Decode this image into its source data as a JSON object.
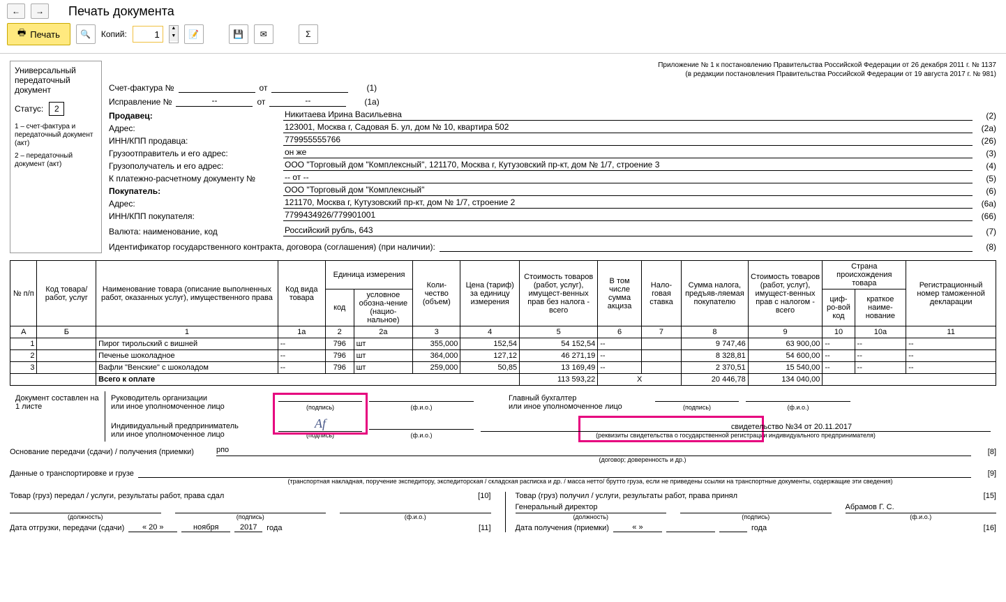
{
  "toolbar": {
    "title": "Печать документа",
    "print": "Печать",
    "copies_lbl": "Копий:",
    "copies": "1"
  },
  "sidebar": {
    "l1": "Универсальный",
    "l2": "передаточный",
    "l3": "документ",
    "status_lbl": "Статус:",
    "status": "2",
    "n1": "1 – счет-фактура и передаточный документ (акт)",
    "n2": "2 – передаточный документ (акт)"
  },
  "hdr": {
    "r1": "Приложение № 1 к постановлению Правительства Российской Федерации от 26 декабря 2011 г. № 1137",
    "r2": "(в редакции постановления Правительства Российской Федерации от 19 августа 2017 г. № 981)"
  },
  "sf": {
    "l1": "Счет-фактура №",
    "ot": "от",
    "n1": "(1)",
    "l2": "Исправление №",
    "dash": "--",
    "n2": "(1а)"
  },
  "f": {
    "seller_l": "Продавец:",
    "seller_v": "Никитаева Ирина Васильевна",
    "seller_n": "(2)",
    "addr_l": "Адрес:",
    "addr_v": "123001, Москва г, Садовая Б. ул, дом № 10, квартира 502",
    "addr_n": "(2а)",
    "inn_l": "ИНН/КПП продавца:",
    "inn_v": "779955555766",
    "inn_n": "(26)",
    "ship_l": "Грузоотправитель и его адрес:",
    "ship_v": "он же",
    "ship_n": "(3)",
    "cons_l": "Грузополучатель и его адрес:",
    "cons_v": "ООО \"Торговый дом \"Комплексный\", 121170, Москва г, Кутузовский пр-кт, дом № 1/7, строение 3",
    "cons_n": "(4)",
    "pay_l": "К платежно-расчетному документу №",
    "pay_v": "-- от --",
    "pay_n": "(5)",
    "buyer_l": "Покупатель:",
    "buyer_v": "ООО \"Торговый дом \"Комплексный\"",
    "buyer_n": "(6)",
    "baddr_l": "Адрес:",
    "baddr_v": "121170, Москва г, Кутузовский пр-кт, дом № 1/7, строение 2",
    "baddr_n": "(6а)",
    "binn_l": "ИНН/КПП покупателя:",
    "binn_v": "7799434926/779901001",
    "binn_n": "(66)",
    "cur_l": "Валюта: наименование, код",
    "cur_v": "Российский рубль, 643",
    "cur_n": "(7)",
    "gk_l": "Идентификатор государственного контракта, договора (соглашения) (при наличии):",
    "gk_v": "",
    "gk_n": "(8)"
  },
  "th": {
    "c1": "№ п/п",
    "c2": "Код товара/ работ, услуг",
    "c3": "Наименование товара (описание выполненных работ, оказанных услуг), имущественного права",
    "c4": "Код вида товара",
    "c5": "Единица измерения",
    "c5a": "код",
    "c5b": "условное обозна-чение (нацио-нальное)",
    "c6": "Коли-чество (объем)",
    "c7": "Цена (тариф) за единицу измерения",
    "c8": "Стоимость товаров (работ, услуг), имущест-венных прав без налога - всего",
    "c9": "В том числе сумма акциза",
    "c10": "Нало-говая ставка",
    "c11": "Сумма налога, предъяв-ляемая покупателю",
    "c12": "Стоимость товаров (работ, услуг), имущест-венных прав с налогом - всего",
    "c13": "Страна происхождения товара",
    "c13a": "циф-ро-вой код",
    "c13b": "краткое наиме-нование",
    "c14": "Регистрационный номер таможенной декларации",
    "rA": "А",
    "rB": "Б",
    "r1": "1",
    "r1a": "1а",
    "r2": "2",
    "r2a": "2а",
    "r3": "3",
    "r4": "4",
    "r5": "5",
    "r6": "6",
    "r7": "7",
    "r8": "8",
    "r9": "9",
    "r10": "10",
    "r10a": "10а",
    "r11": "11"
  },
  "rows": [
    {
      "n": "1",
      "name": "Пирог тирольский с вишней",
      "kvt": "--",
      "kod": "796",
      "ed": "шт",
      "qty": "355,000",
      "price": "152,54",
      "sum": "54 152,54",
      "akc": "--",
      "st": "",
      "tax": "9 747,46",
      "tot": "63 900,00",
      "c10": "--",
      "c10a": "--",
      "c11": "--"
    },
    {
      "n": "2",
      "name": "Печенье шоколадное",
      "kvt": "--",
      "kod": "796",
      "ed": "шт",
      "qty": "364,000",
      "price": "127,12",
      "sum": "46 271,19",
      "akc": "--",
      "st": "",
      "tax": "8 328,81",
      "tot": "54 600,00",
      "c10": "--",
      "c10a": "--",
      "c11": "--"
    },
    {
      "n": "3",
      "name": "Вафли \"Венские\" с шоколадом",
      "kvt": "--",
      "kod": "796",
      "ed": "шт",
      "qty": "259,000",
      "price": "50,85",
      "sum": "13 169,49",
      "akc": "--",
      "st": "",
      "tax": "2 370,51",
      "tot": "15 540,00",
      "c10": "--",
      "c10a": "--",
      "c11": "--"
    }
  ],
  "total": {
    "lbl": "Всего к оплате",
    "sum": "113 593,22",
    "x": "Х",
    "tax": "20 446,78",
    "tot": "134 040,00"
  },
  "sign": {
    "doc": "Документ составлен на",
    "sheets": "1 листе",
    "r1": "Руководитель организации",
    "r2": "или иное уполномоченное лицо",
    "ip1": "Индивидуальный предприниматель",
    "ip2": "или иное уполномоченное лицо",
    "gb1": "Главный бухгалтер",
    "gb2": "или иное уполномоченное лицо",
    "pod": "(подпись)",
    "fio": "(ф.и.о.)",
    "rekv": "(реквизиты свидетельства о государственной регистрации индивидуального предпринимателя)",
    "cert": "свидетельство №34 от 20.11.2017"
  },
  "foot": {
    "osn_l": "Основание передачи (сдачи) / получения (приемки)",
    "osn_v": "рпо",
    "osn_c": "(договор; доверенность и др.)",
    "osn_n": "[8]",
    "tr_l": "Данные о транспортировке и грузе",
    "tr_c": "(транспортная накладная, поручение экспедитору, экспедиторская / складская расписка и др. / масса нетто/ брутто груза, если не приведены ссылки на транспортные документы, содержащие эти сведения)",
    "tr_n": "[9]"
  },
  "bot": {
    "left_t": "Товар (груз) передал / услуги, результаты работ, права сдал",
    "left_n": "[10]",
    "right_t": "Товар (груз) получил / услуги, результаты работ, права принял",
    "right_n": "[15]",
    "right_pos": "Генеральный директор",
    "right_fio": "Абрамов Г. С.",
    "dol": "(должность)",
    "pod": "(подпись)",
    "fio": "(ф.и.о.)",
    "ship_l": "Дата отгрузки, передачи (сдачи)",
    "ship_d": "« 20 »",
    "ship_m": "ноября",
    "ship_y": "2017",
    "ship_g": "года",
    "ship_n": "[11]",
    "recv_l": "Дата получения (приемки)",
    "recv_d": "«       »",
    "recv_n": "[16]"
  }
}
